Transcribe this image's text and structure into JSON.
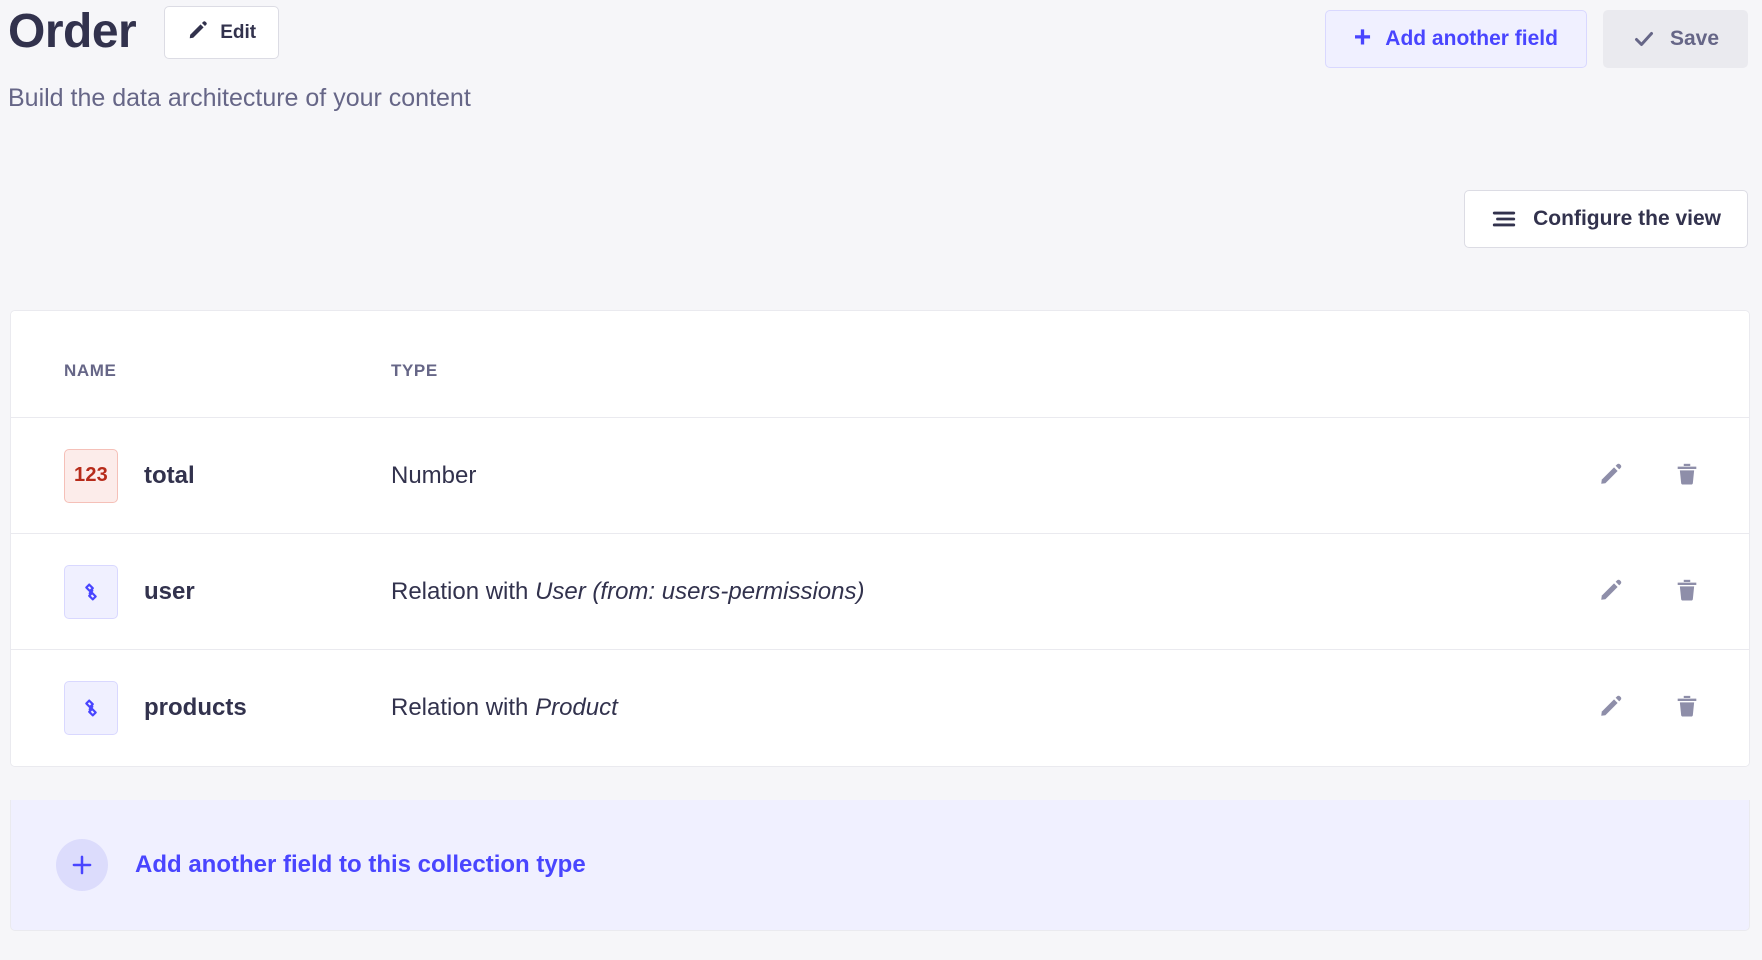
{
  "header": {
    "title": "Order",
    "subtitle": "Build the data architecture of your content",
    "edit_label": "Edit",
    "add_field_label": "Add another field",
    "save_label": "Save",
    "plus_glyph": "+",
    "icons": {
      "edit": "pencil-icon",
      "add": "plus-icon",
      "save": "check-icon"
    }
  },
  "toolbar": {
    "configure_label": "Configure the view",
    "configure_icon": "filter-lines-icon"
  },
  "table": {
    "columns": [
      {
        "key": "name",
        "label": "NAME"
      },
      {
        "key": "type",
        "label": "TYPE"
      }
    ],
    "rows": [
      {
        "icon": "number-123-icon",
        "icon_kind": "number",
        "icon_text": "123",
        "name": "total",
        "type_prefix": "Number",
        "type_emphasis": "",
        "edit_icon": "pencil-icon",
        "delete_icon": "trash-icon"
      },
      {
        "icon": "relation-link-icon",
        "icon_kind": "relation",
        "icon_text": "",
        "name": "user",
        "type_prefix": "Relation with ",
        "type_emphasis": "User (from: users-permissions)",
        "edit_icon": "pencil-icon",
        "delete_icon": "trash-icon"
      },
      {
        "icon": "relation-link-icon",
        "icon_kind": "relation",
        "icon_text": "",
        "name": "products",
        "type_prefix": "Relation with ",
        "type_emphasis": "Product",
        "edit_icon": "pencil-icon",
        "delete_icon": "trash-icon"
      }
    ]
  },
  "footer": {
    "add_label": "Add another field to this collection type",
    "plus_icon": "plus-icon"
  },
  "colors": {
    "page_background": "#f6f6f9",
    "card_background": "#ffffff",
    "primary": "#4945ff",
    "primary_soft": "#f0f0ff",
    "primary_border": "#d9d8ff",
    "text_dark": "#32324d",
    "text_muted": "#666687",
    "border": "#eaeaef",
    "danger_text": "#b72b1a",
    "danger_soft": "#fcecea",
    "danger_border": "#f5c0b8",
    "disabled_bg": "#eaeaef"
  }
}
